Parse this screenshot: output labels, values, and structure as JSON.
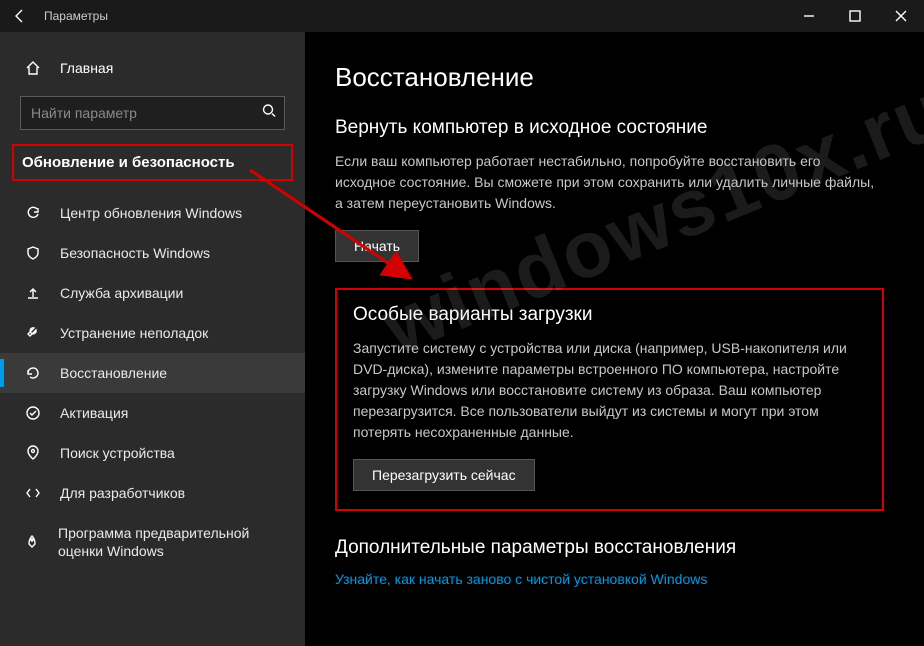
{
  "titlebar": {
    "title": "Параметры"
  },
  "sidebar": {
    "home_label": "Главная",
    "search_placeholder": "Найти параметр",
    "section_title": "Обновление и безопасность",
    "items": [
      {
        "label": "Центр обновления Windows"
      },
      {
        "label": "Безопасность Windows"
      },
      {
        "label": "Служба архивации"
      },
      {
        "label": "Устранение неполадок"
      },
      {
        "label": "Восстановление"
      },
      {
        "label": "Активация"
      },
      {
        "label": "Поиск устройства"
      },
      {
        "label": "Для разработчиков"
      },
      {
        "label": "Программа предварительной оценки Windows"
      }
    ]
  },
  "content": {
    "page_title": "Восстановление",
    "reset": {
      "heading": "Вернуть компьютер в исходное состояние",
      "desc": "Если ваш компьютер работает нестабильно, попробуйте восстановить его исходное состояние. Вы сможете при этом сохранить или удалить личные файлы, а затем переустановить Windows.",
      "button": "Начать"
    },
    "advanced": {
      "heading": "Особые варианты загрузки",
      "desc": "Запустите систему с устройства или диска (например, USB-накопителя или DVD-диска), измените параметры встроенного ПО компьютера, настройте загрузку Windows или восстановите систему из образа. Ваш компьютер перезагрузится. Все пользователи выйдут из системы и могут при этом потерять несохраненные данные.",
      "button": "Перезагрузить сейчас"
    },
    "more": {
      "heading": "Дополнительные параметры восстановления",
      "link": "Узнайте, как начать заново с чистой установкой Windows"
    }
  },
  "watermark": "windows10x.ru"
}
